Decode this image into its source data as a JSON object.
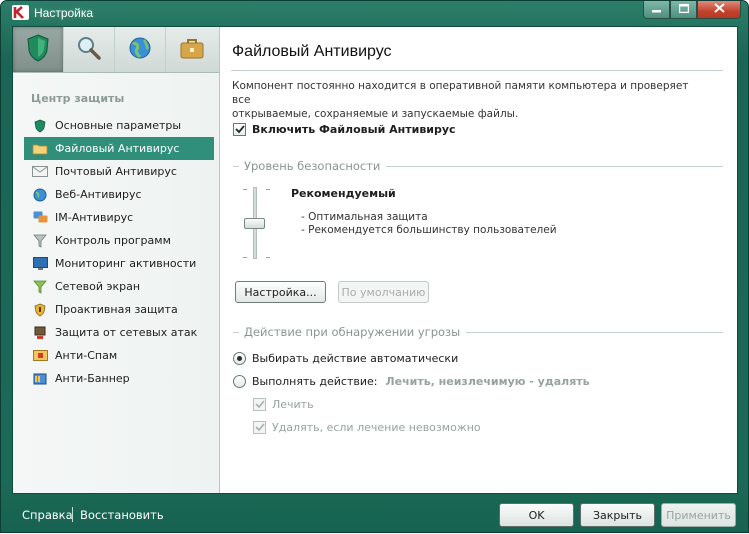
{
  "window": {
    "title": "Настройка",
    "minimize_icon": "minimize-icon",
    "maximize_icon": "maximize-icon",
    "close_icon": "close-icon"
  },
  "sidebar": {
    "tabs": [
      {
        "icon": "shield-icon",
        "selected": true
      },
      {
        "icon": "magnifier-icon",
        "selected": false
      },
      {
        "icon": "globe-update-icon",
        "selected": false
      },
      {
        "icon": "briefcase-icon",
        "selected": false
      }
    ],
    "section_title": "Центр защиты",
    "items": [
      {
        "label": "Основные параметры",
        "icon": "shield-icon"
      },
      {
        "label": "Файловый Антивирус",
        "icon": "folder-icon"
      },
      {
        "label": "Почтовый Антивирус",
        "icon": "envelope-icon"
      },
      {
        "label": "Веб-Антивирус",
        "icon": "globe-icon"
      },
      {
        "label": "IM-Антивирус",
        "icon": "chat-icon"
      },
      {
        "label": "Контроль программ",
        "icon": "funnel-icon"
      },
      {
        "label": "Мониторинг активности",
        "icon": "monitor-icon"
      },
      {
        "label": "Сетевой экран",
        "icon": "firewall-icon"
      },
      {
        "label": "Проактивная защита",
        "icon": "proactive-shield-icon"
      },
      {
        "label": "Защита от сетевых атак",
        "icon": "network-attack-icon"
      },
      {
        "label": "Анти-Спам",
        "icon": "antispam-icon"
      },
      {
        "label": "Анти-Баннер",
        "icon": "antibanner-icon"
      }
    ],
    "selected_index": 1
  },
  "main": {
    "title": "Файловый Антивирус",
    "description_line1": "Компонент постоянно находится в оперативной памяти компьютера и проверяет все",
    "description_line2": "открываемые, сохраняемые и запускаемые файлы.",
    "enable_label": "Включить Файловый Антивирус",
    "enable_checked": true,
    "security_level": {
      "header": "Уровень безопасности",
      "name": "Рекомендуемый",
      "detail1": "- Оптимальная защита",
      "detail2": "- Рекомендуется большинству пользователей",
      "level_step": 2,
      "level_steps": 3,
      "settings_button": "Настройка...",
      "default_button": "По умолчанию"
    },
    "action": {
      "header": "Действие при обнаружении угрозы",
      "auto_label": "Выбирать действие автоматически",
      "auto_selected": true,
      "manual_label": "Выполнять действие:",
      "manual_value": "Лечить, неизлечимую - удалять",
      "disinfect_label": "Лечить",
      "delete_label": "Удалять, если лечение невозможно"
    }
  },
  "footer": {
    "help_link": "Справка",
    "restore_link": "Восстановить",
    "ok_button": "OK",
    "close_button": "Закрыть",
    "apply_button": "Применить"
  },
  "colors": {
    "frame": "#1b6a56",
    "selection": "#2f8f7b"
  }
}
